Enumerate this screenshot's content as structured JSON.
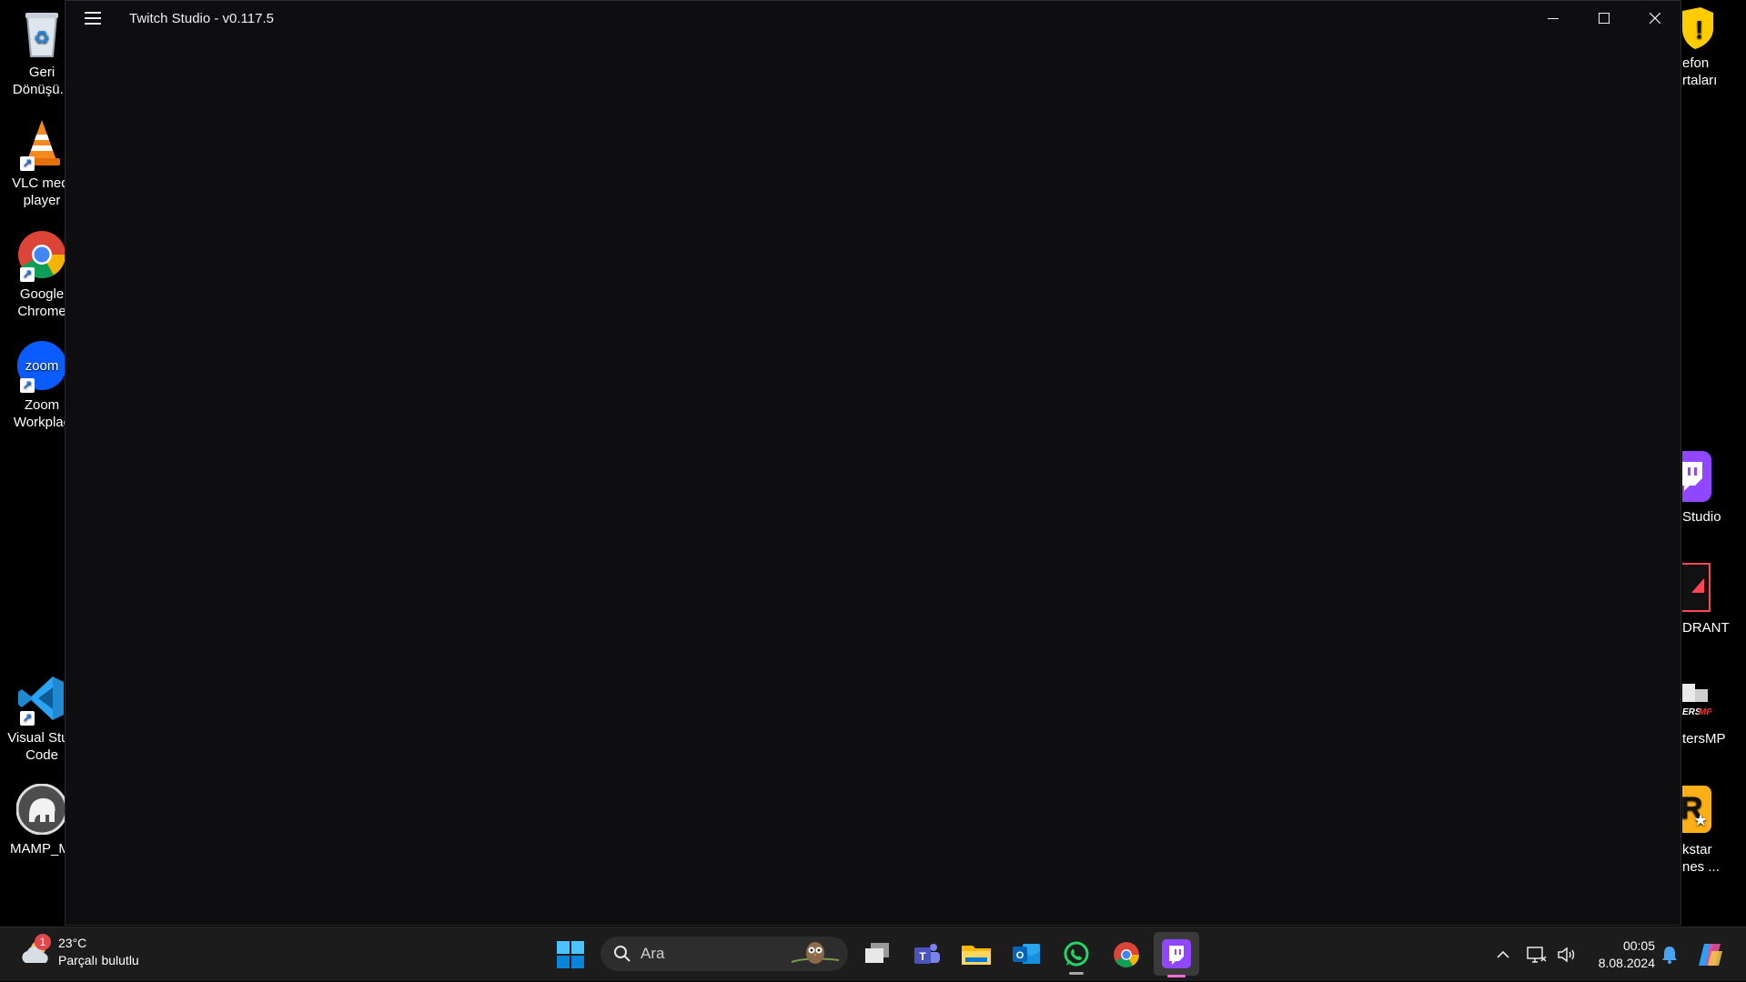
{
  "desktop": {
    "left_icons": [
      {
        "label_line1": "Geri",
        "label_line2": "Dönüşü..."
      },
      {
        "label_line1": "VLC medi",
        "label_line2": "player"
      },
      {
        "label_line1": "Google",
        "label_line2": "Chrome"
      },
      {
        "label_line1": "Zoom",
        "label_line2": "Workplac"
      },
      {
        "label_line1": "Visual Stud",
        "label_line2": "Code"
      },
      {
        "label_line1": "MAMP_M/",
        "label_line2": ""
      }
    ],
    "right_icons": [
      {
        "label_line1": "efon",
        "label_line2": "rtaları"
      },
      {
        "label_line1": "Studio",
        "label_line2": ""
      },
      {
        "label_line1": "DRANT",
        "label_line2": ""
      },
      {
        "label_line1": "tersMP",
        "label_line2": ""
      },
      {
        "label_line1": "kstar",
        "label_line2": "nes ..."
      }
    ],
    "zoom_logo_text": "zoom"
  },
  "window": {
    "title": "Twitch Studio - v0.117.5",
    "controls": {
      "minimize": "minimize",
      "maximize": "maximize",
      "close": "close"
    }
  },
  "taskbar": {
    "weather": {
      "temp": "23°C",
      "condition": "Parçalı bulutlu",
      "badge": "1"
    },
    "search": {
      "placeholder": "Ara"
    },
    "clock": {
      "time": "00:05",
      "date": "8.08.2024"
    },
    "pinned": [
      "windows-start",
      "task-view",
      "teams",
      "file-explorer",
      "outlook",
      "whatsapp",
      "chrome",
      "twitch-studio"
    ]
  },
  "colors": {
    "twitch_purple": "#9146ff",
    "window_bg": "#0e0e10",
    "taskbar_bg": "#1c1c1c",
    "accent_blue": "#0078d4"
  }
}
